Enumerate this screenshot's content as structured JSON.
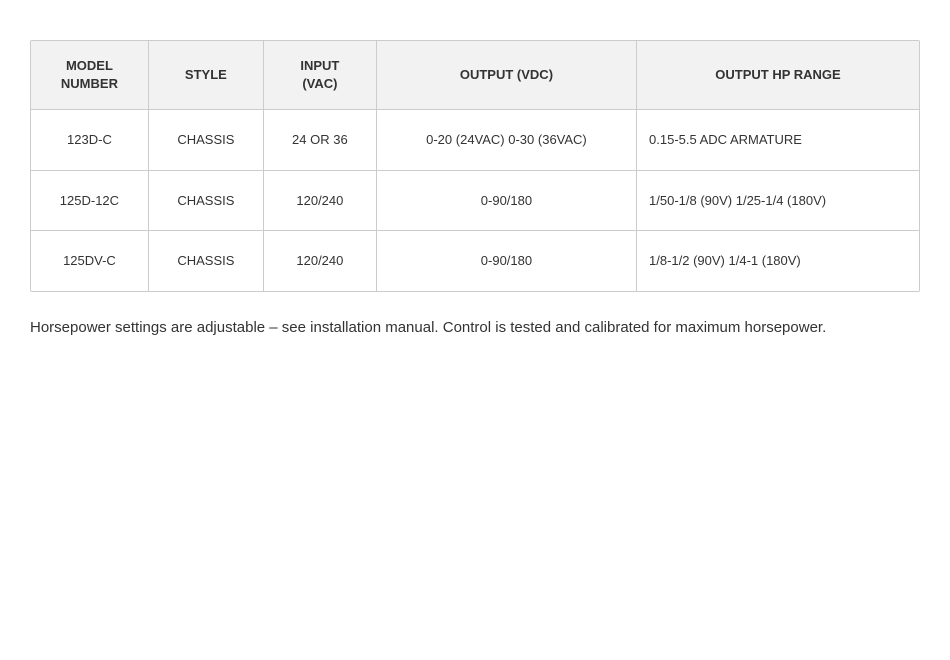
{
  "table": {
    "headers": [
      {
        "id": "model-number",
        "label": "MODEL\nNUMBER"
      },
      {
        "id": "style",
        "label": "STYLE"
      },
      {
        "id": "input-vac",
        "label": "INPUT\n(VAC)"
      },
      {
        "id": "output-vdc",
        "label": "OUTPUT (VDC)"
      },
      {
        "id": "output-hp-range",
        "label": "OUTPUT HP RANGE"
      }
    ],
    "rows": [
      {
        "model": "123D-C",
        "style": "CHASSIS",
        "input": "24 OR 36",
        "output_vdc": "0-20 (24VAC) 0-30 (36VAC)",
        "output_hp": "0.15-5.5 ADC ARMATURE"
      },
      {
        "model": "125D-12C",
        "style": "CHASSIS",
        "input": "120/240",
        "output_vdc": "0-90/180",
        "output_hp": "1/50-1/8 (90V) 1/25-1/4 (180V)"
      },
      {
        "model": "125DV-C",
        "style": "CHASSIS",
        "input": "120/240",
        "output_vdc": "0-90/180",
        "output_hp": "1/8-1/2 (90V) 1/4-1 (180V)"
      }
    ]
  },
  "footer_note": "Horsepower settings are adjustable – see installation manual. Control is tested and calibrated for maximum horsepower."
}
